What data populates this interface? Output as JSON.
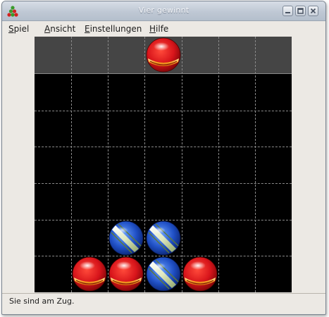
{
  "window": {
    "title": "Vier gewinnt"
  },
  "menu": [
    {
      "accel": "S",
      "rest": "piel"
    },
    {
      "accel": "A",
      "rest": "nsicht"
    },
    {
      "accel": "E",
      "rest": "instellungen"
    },
    {
      "accel": "H",
      "rest": "ilfe"
    }
  ],
  "board": {
    "columns": 7,
    "rows": 6,
    "hover_column": 4,
    "hover_color": "red",
    "cells": [
      [
        null,
        null,
        null,
        null,
        null,
        null,
        null
      ],
      [
        null,
        null,
        null,
        null,
        null,
        null,
        null
      ],
      [
        null,
        null,
        null,
        null,
        null,
        null,
        null
      ],
      [
        null,
        null,
        null,
        null,
        null,
        null,
        null
      ],
      [
        null,
        null,
        "blue",
        "blue",
        null,
        null,
        null
      ],
      [
        null,
        "red",
        "red",
        "blue",
        "red",
        null,
        null
      ]
    ],
    "colors": {
      "red_piece": "#d8151b",
      "blue_piece": "#1f4fc4",
      "drop_row_bg": "#454545",
      "board_bg": "#000000"
    }
  },
  "status": {
    "text": "Sie sind am Zug."
  }
}
